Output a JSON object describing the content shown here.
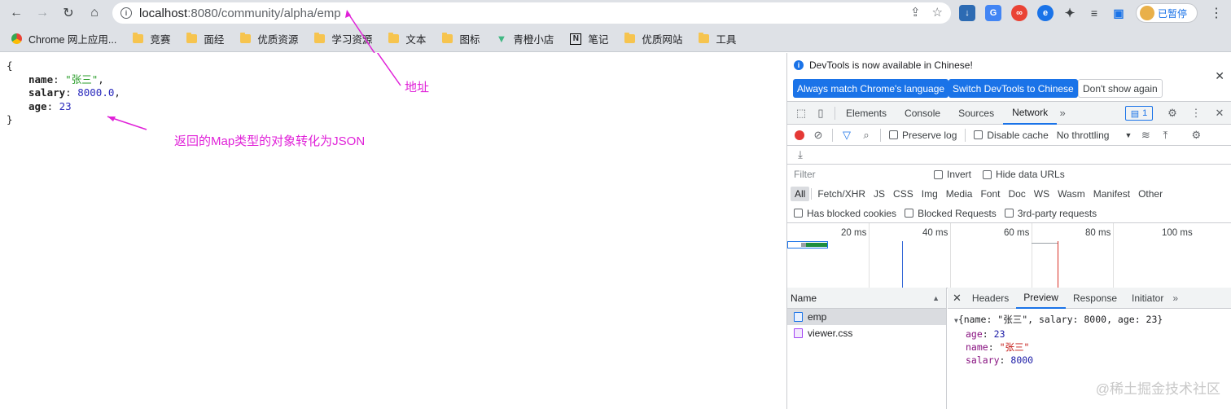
{
  "browser": {
    "url_host": "localhost",
    "url_path": ":8080/community/alpha/emp",
    "profile_label": "已暂停",
    "bookmarks": [
      {
        "label": "Chrome 网上应用...",
        "icon": "chrome-apps-icon"
      },
      {
        "label": "竞赛",
        "icon": "folder-icon"
      },
      {
        "label": "面经",
        "icon": "folder-icon"
      },
      {
        "label": "优质资源",
        "icon": "folder-icon"
      },
      {
        "label": "学习资源",
        "icon": "folder-icon"
      },
      {
        "label": "文本",
        "icon": "folder-icon"
      },
      {
        "label": "图标",
        "icon": "folder-icon"
      },
      {
        "label": "青橙小店",
        "icon": "vue-icon"
      },
      {
        "label": "笔记",
        "icon": "notion-icon"
      },
      {
        "label": "优质网站",
        "icon": "folder-icon"
      },
      {
        "label": "工具",
        "icon": "folder-icon"
      }
    ]
  },
  "page": {
    "json": {
      "open": "{",
      "close": "}",
      "name_key": "name",
      "name_val": "\"张三\"",
      "salary_key": "salary",
      "salary_val": "8000.0",
      "age_key": "age",
      "age_val": "23"
    },
    "annotations": {
      "address": "地址",
      "result": "返回的Map类型的对象转化为JSON"
    },
    "annotation_color": "#e021d8"
  },
  "devtools": {
    "infobar": {
      "message": "DevTools is now available in Chinese!",
      "btn_match": "Always match Chrome's language",
      "btn_switch": "Switch DevTools to Chinese",
      "btn_dismiss": "Don't show again"
    },
    "tabs": [
      "Elements",
      "Console",
      "Sources",
      "Network"
    ],
    "active_tab": "Network",
    "issues_count": "1",
    "toolbar": {
      "preserve_log": "Preserve log",
      "disable_cache": "Disable cache",
      "throttling": "No throttling"
    },
    "filter": {
      "placeholder": "Filter",
      "invert": "Invert",
      "hide_data_urls": "Hide data URLs"
    },
    "types": [
      "All",
      "Fetch/XHR",
      "JS",
      "CSS",
      "Img",
      "Media",
      "Font",
      "Doc",
      "WS",
      "Wasm",
      "Manifest",
      "Other"
    ],
    "cookies": {
      "blocked_cookies": "Has blocked cookies",
      "blocked_requests": "Blocked Requests",
      "third_party": "3rd-party requests"
    },
    "timeline_ticks": [
      "20 ms",
      "40 ms",
      "60 ms",
      "80 ms",
      "100 ms"
    ],
    "name_header": "Name",
    "requests": [
      {
        "name": "emp",
        "type": "doc"
      },
      {
        "name": "viewer.css",
        "type": "css"
      }
    ],
    "detail_tabs": [
      "Headers",
      "Preview",
      "Response",
      "Initiator"
    ],
    "active_detail_tab": "Preview",
    "preview": {
      "summary": "{name: \"张三\", salary: 8000, age: 23}",
      "age_key": "age",
      "age_val": "23",
      "name_key": "name",
      "name_val": "\"张三\"",
      "salary_key": "salary",
      "salary_val": "8000"
    }
  },
  "watermark": "@稀土掘金技术社区"
}
